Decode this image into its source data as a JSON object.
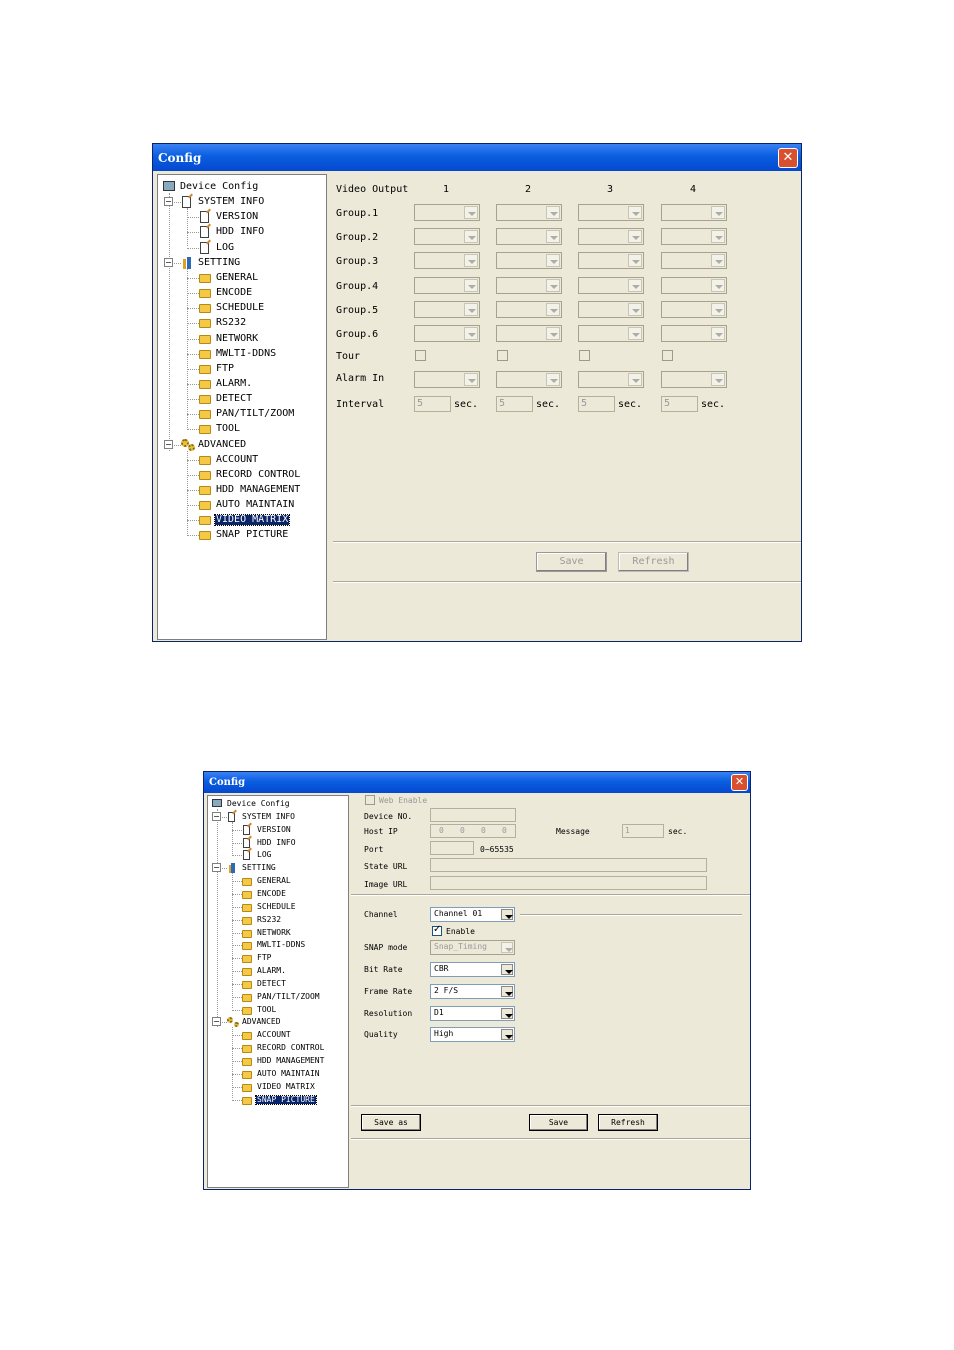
{
  "win1": {
    "title": "Config",
    "tree": {
      "root": "Device Config",
      "system_info": "SYSTEM INFO",
      "system_items": [
        "VERSION",
        "HDD INFO",
        "LOG"
      ],
      "setting": "SETTING",
      "setting_items": [
        "GENERAL",
        "ENCODE",
        "SCHEDULE",
        "RS232",
        "NETWORK",
        "MWLTI-DDNS",
        "FTP",
        "ALARM.",
        "DETECT",
        "PAN/TILT/ZOOM",
        "TOOL"
      ],
      "advanced": "ADVANCED",
      "advanced_items": [
        "ACCOUNT",
        "RECORD CONTROL",
        "HDD MANAGEMENT",
        "AUTO MAINTAIN",
        "VIDEO MATRIX",
        "SNAP PICTURE"
      ],
      "selected": "VIDEO MATRIX"
    },
    "matrix": {
      "header": "Video Output",
      "columns": [
        "1",
        "2",
        "3",
        "4"
      ],
      "rows": [
        "Group.1",
        "Group.2",
        "Group.3",
        "Group.4",
        "Group.5",
        "Group.6"
      ],
      "tour_label": "Tour",
      "alarm_label": "Alarm In",
      "interval_label": "Interval",
      "interval_value": "5",
      "interval_unit": "sec."
    },
    "buttons": {
      "save": "Save",
      "refresh": "Refresh"
    }
  },
  "win2": {
    "title": "Config",
    "tree": {
      "root": "Device Config",
      "system_info": "SYSTEM INFO",
      "system_items": [
        "VERSION",
        "HDD INFO",
        "LOG"
      ],
      "setting": "SETTING",
      "setting_items": [
        "GENERAL",
        "ENCODE",
        "SCHEDULE",
        "RS232",
        "NETWORK",
        "MWLTI-DDNS",
        "FTP",
        "ALARM.",
        "DETECT",
        "PAN/TILT/ZOOM",
        "TOOL"
      ],
      "advanced": "ADVANCED",
      "advanced_items": [
        "ACCOUNT",
        "RECORD CONTROL",
        "HDD MANAGEMENT",
        "AUTO MAINTAIN",
        "VIDEO MATRIX",
        "SNAP PICTURE"
      ],
      "selected": "SNAP PICTURE"
    },
    "web": {
      "web_enable": "Web Enable",
      "device_no": "Device NO.",
      "host_ip": "Host IP",
      "ip": [
        "0",
        "0",
        "0",
        "0"
      ],
      "message": "Message",
      "message_value": "1",
      "message_unit": "sec.",
      "port": "Port",
      "port_range": "0~65535",
      "state_url": "State URL",
      "image_url": "Image URL"
    },
    "snap": {
      "channel_label": "Channel",
      "channel": "Channel 01",
      "enable": "Enable",
      "snap_mode_label": "SNAP mode",
      "snap_mode": "Snap_Timing",
      "bit_rate_label": "Bit Rate",
      "bit_rate": "CBR",
      "frame_rate_label": "Frame Rate",
      "frame_rate": "2 F/S",
      "resolution_label": "Resolution",
      "resolution": "D1",
      "quality_label": "Quality",
      "quality": "High"
    },
    "buttons": {
      "save_as": "Save as",
      "save": "Save",
      "refresh": "Refresh"
    }
  }
}
